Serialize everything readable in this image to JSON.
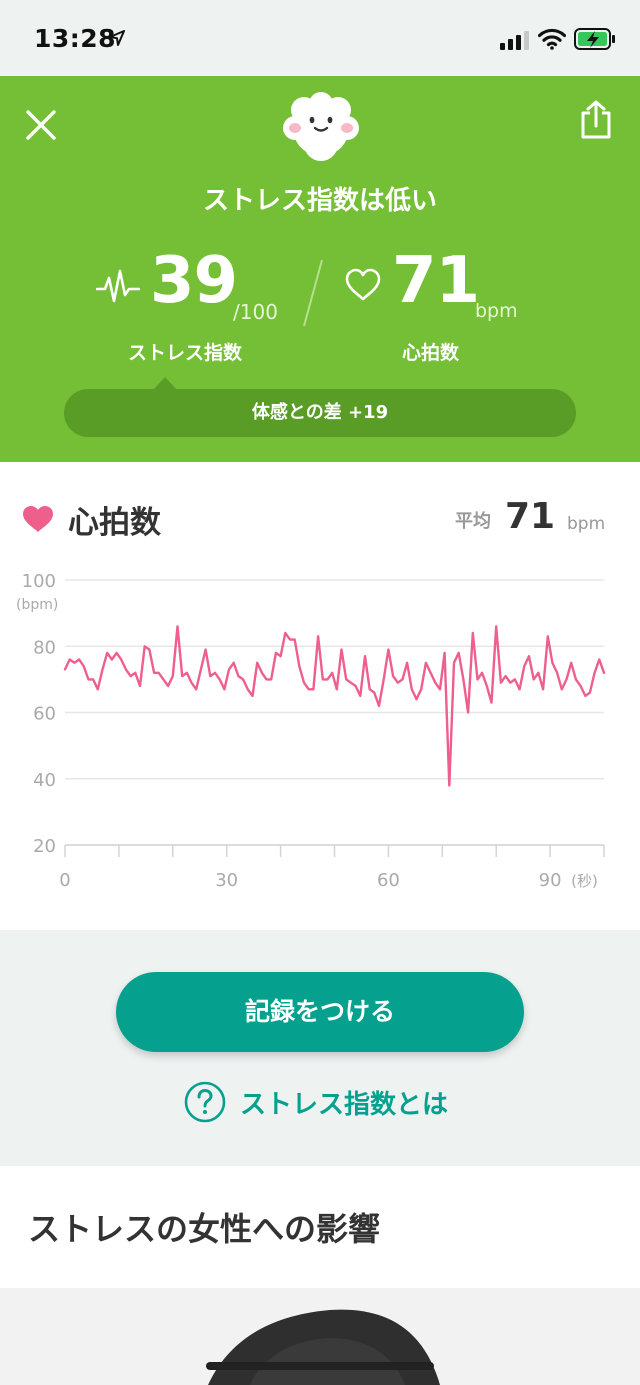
{
  "status_bar": {
    "time": "13:28"
  },
  "header": {
    "title": "ストレス指数は低い",
    "stress_value": "39",
    "stress_max": "/100",
    "stress_label": "ストレス指数",
    "hr_value": "71",
    "hr_unit": "bpm",
    "hr_label": "心拍数",
    "difference_text": "体感との差 +19",
    "colors": {
      "background": "#74bf35",
      "pill": "#5a9d26"
    }
  },
  "heart_rate_card": {
    "title": "心拍数",
    "average_label": "平均",
    "average_value": "71",
    "average_unit": "bpm"
  },
  "chart_data": {
    "type": "line",
    "series": [
      {
        "values": [
          73,
          76,
          75,
          76,
          74,
          70,
          70,
          67,
          73,
          78,
          76,
          78,
          76,
          73,
          71,
          72,
          68,
          80,
          79,
          72,
          72,
          70,
          68,
          71,
          86,
          71,
          72,
          69,
          67,
          73,
          79,
          71,
          72,
          70,
          67,
          73,
          75,
          71,
          70,
          67,
          65,
          75,
          72,
          70,
          70,
          78,
          77,
          84,
          82,
          82,
          74,
          69,
          67,
          67,
          83,
          70,
          70,
          72,
          67,
          79,
          70,
          69,
          68,
          65,
          77,
          67,
          66,
          62,
          70,
          79,
          71,
          69,
          70,
          75,
          67,
          64,
          67,
          75,
          72,
          69,
          67,
          78,
          38,
          75,
          78,
          70,
          60,
          84,
          70,
          72,
          68,
          63,
          86,
          69,
          71,
          69,
          70,
          67,
          74,
          77,
          70,
          72,
          67,
          83,
          75,
          72,
          67,
          70,
          75,
          70,
          68,
          65,
          66,
          72,
          76,
          72
        ]
      }
    ],
    "x_min": 0,
    "x_max": 100,
    "x_ticks": [
      "0",
      "30",
      "60",
      "90"
    ],
    "x_unit": "(秒)",
    "y_ticks": [
      "20",
      "40",
      "60",
      "80",
      "100"
    ],
    "y_unit": "(bpm)",
    "ylim": [
      20,
      100
    ],
    "line_color": "#ee5f8c",
    "grid": true
  },
  "actions": {
    "record_label": "記録をつける",
    "about_label": "ストレス指数とは"
  },
  "article": {
    "title": "ストレスの女性への影響"
  },
  "colors": {
    "accent": "#06a08f",
    "heart": "#ee5f8c"
  },
  "icons": [
    "location-arrow-icon",
    "signal-icon",
    "wifi-icon",
    "battery-charging-icon",
    "close-icon",
    "share-icon",
    "mascot-icon",
    "stress-wave-icon",
    "heart-outline-icon",
    "heart-filled-icon",
    "question-icon"
  ]
}
